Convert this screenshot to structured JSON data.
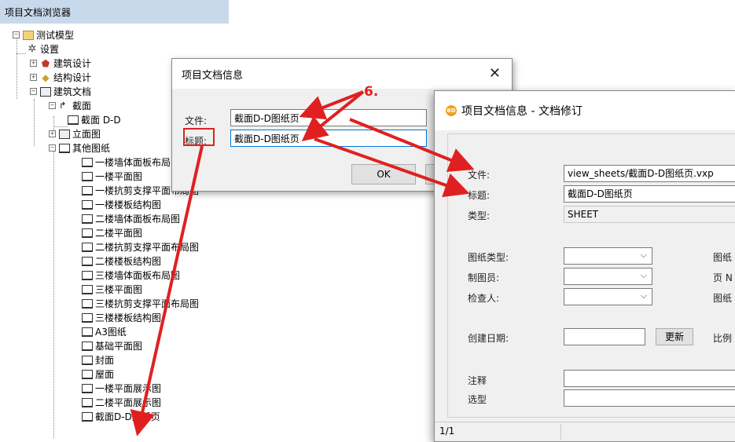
{
  "browser": {
    "title": "项目文档浏览器"
  },
  "tree": {
    "root": "测试模型",
    "settings": "设置",
    "arch_design": "建筑设计",
    "struct_design": "结构设计",
    "arch_docs": "建筑文档",
    "section": "截面",
    "section_dd": "截面 D-D",
    "elevation": "立面图",
    "other_drawings": "其他图纸",
    "sheets": [
      "一楼墙体面板布局图",
      "一楼平面图",
      "一楼抗剪支撑平面布局图",
      "一楼楼板结构图",
      "二楼墙体面板布局图",
      "二楼平面图",
      "二楼抗剪支撑平面布局图",
      "二楼楼板结构图",
      "三楼墙体面板布局图",
      "三楼平面图",
      "三楼抗剪支撑平面布局图",
      "三楼楼板结构图",
      "A3图纸",
      "基础平面图",
      "封面",
      "屋面",
      "一楼平面展示图",
      "二楼平面展示图",
      "截面D-D图纸页"
    ]
  },
  "dialog1": {
    "title": "项目文档信息",
    "close": "✕",
    "file_label": "文件:",
    "file_value": "截面D-D图纸页",
    "title_label": "标题:",
    "title_value": "截面D-D图纸页",
    "ok": "OK"
  },
  "dialog2": {
    "title": "项目文档信息 - 文档修订",
    "logo": "BD",
    "file_label": "文件:",
    "file_value": "view_sheets/截面D-D图纸页.vxp",
    "title_label": "标题:",
    "title_value": "截面D-D图纸页",
    "type_label": "类型:",
    "type_value": "SHEET",
    "sheet_type_label": "图纸类型:",
    "drafter_label": "制图员:",
    "checker_label": "检查人:",
    "right_label_1": "图纸",
    "right_label_2": "页 N",
    "right_label_3": "图纸",
    "created_label": "创建日期:",
    "update_button": "更新",
    "scale_label": "比例",
    "notes_label": "注释",
    "selection_label": "选型",
    "page_indicator": "1/1"
  },
  "annotation": {
    "step": "6.",
    "color": "#e02020"
  }
}
